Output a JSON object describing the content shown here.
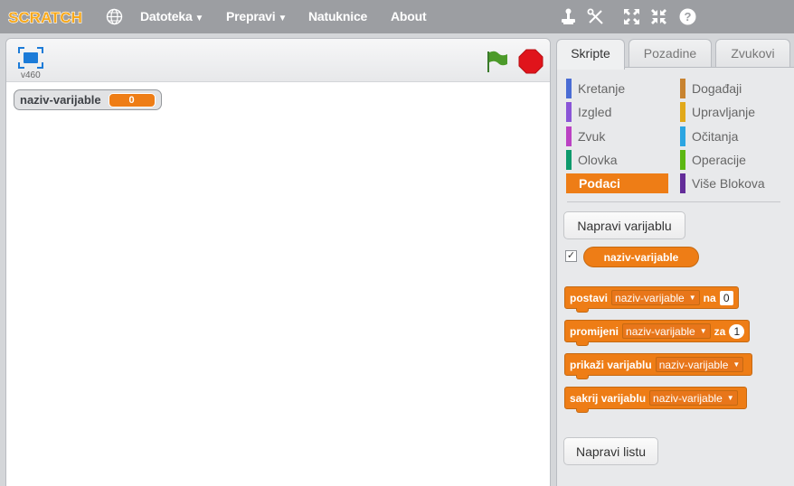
{
  "app": {
    "logo_text": "SCRATCH"
  },
  "menu": {
    "file_label": "Datoteka",
    "edit_label": "Prepravi",
    "tips_label": "Natuknice",
    "about_label": "About"
  },
  "stage": {
    "version": "v460",
    "watcher": {
      "label": "naziv-varijable",
      "value": "0"
    }
  },
  "tabs": [
    {
      "label": "Skripte"
    },
    {
      "label": "Pozadine"
    },
    {
      "label": "Zvukovi"
    }
  ],
  "categories": {
    "left": [
      "Kretanje",
      "Izgled",
      "Zvuk",
      "Olovka",
      "Podaci"
    ],
    "right": [
      "Događaji",
      "Upravljanje",
      "Očitanja",
      "Operacije",
      "Više Blokova"
    ],
    "selected": "Podaci",
    "colors": {
      "Kretanje": "#4a6cd4",
      "Izgled": "#8a55d7",
      "Zvuk": "#bb42c3",
      "Olovka": "#0e9a6c",
      "Podaci": "#ee7d16",
      "Događaji": "#c88330",
      "Upravljanje": "#e1a91a",
      "Očitanja": "#2ca5e2",
      "Operacije": "#5cb712",
      "Više Blokova": "#632d99"
    }
  },
  "palette": {
    "make_variable_label": "Napravi varijablu",
    "variable_reporter": "naziv-varijable",
    "variable_checked": true,
    "make_list_label": "Napravi listu",
    "blocks": {
      "set": {
        "text": "postavi",
        "var": "naziv-varijable",
        "conj": "na",
        "value": "0"
      },
      "change": {
        "text": "promijeni",
        "var": "naziv-varijable",
        "conj": "za",
        "value": "1"
      },
      "show": {
        "text": "prikaži varijablu",
        "var": "naziv-varijable"
      },
      "hide": {
        "text": "sakrij varijablu",
        "var": "naziv-varijable"
      }
    }
  }
}
